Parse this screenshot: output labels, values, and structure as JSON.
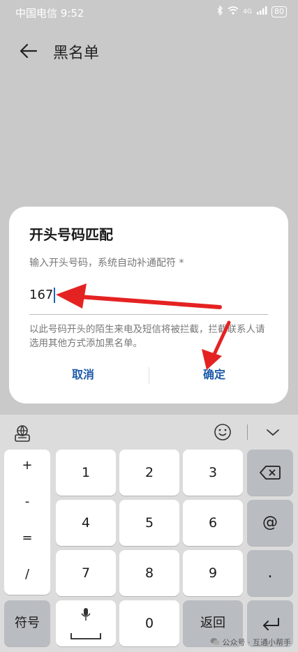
{
  "status_bar": {
    "carrier_time": "中国电信 9:52",
    "network": "4G",
    "battery": "80"
  },
  "page": {
    "title": "黑名单"
  },
  "dialog": {
    "title": "开头号码匹配",
    "hint": "输入开头号码，系统自动补通配符 *",
    "input_value": "167",
    "note": "以此号码开头的陌生来电及短信将被拦截，拦截联系人请选用其他方式添加黑名单。",
    "cancel_label": "取消",
    "ok_label": "确定"
  },
  "keyboard": {
    "symbols": [
      "+",
      "-",
      "=",
      "/"
    ],
    "digits": [
      "1",
      "2",
      "3",
      "4",
      "5",
      "6",
      "7",
      "8",
      "9",
      "0"
    ],
    "symbol_key": "符号",
    "return_key": "返回",
    "right_keys": {
      "at": "@",
      "dot": "."
    },
    "icons": [
      "globe-keyboard-icon",
      "emoji-icon",
      "chevron-down-icon",
      "backspace-icon",
      "microphone-icon",
      "space-icon",
      "enter-icon"
    ]
  },
  "watermark": "公众号 · 互通小帮手",
  "colors": {
    "accent": "#1e5aa8",
    "cursor": "#1565c0",
    "arrow": "#e52222"
  }
}
